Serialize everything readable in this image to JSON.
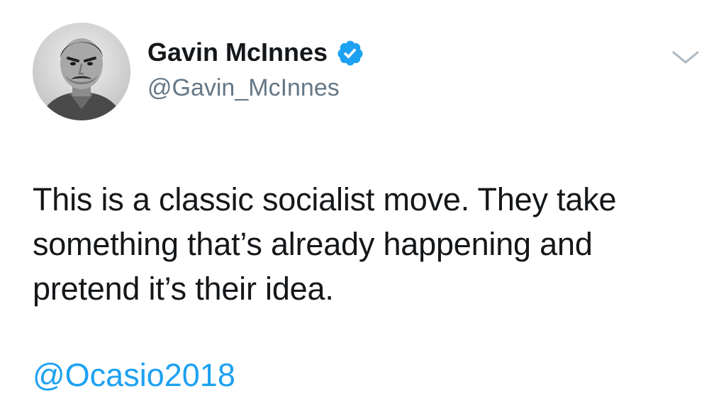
{
  "tweet": {
    "author": {
      "display_name": "Gavin McInnes",
      "handle": "@Gavin_McInnes",
      "verified": true,
      "avatar_icon": "avatar-photo"
    },
    "body": "This is a classic socialist move. They take something that’s already happening and pretend it’s their idea.",
    "mention": "@Ocasio2018",
    "menu_icon": "chevron-down-icon"
  },
  "colors": {
    "text_primary": "#14171a",
    "text_secondary": "#657786",
    "link": "#1da1f2",
    "verified": "#1da1f2",
    "caret": "#aab8c2"
  }
}
